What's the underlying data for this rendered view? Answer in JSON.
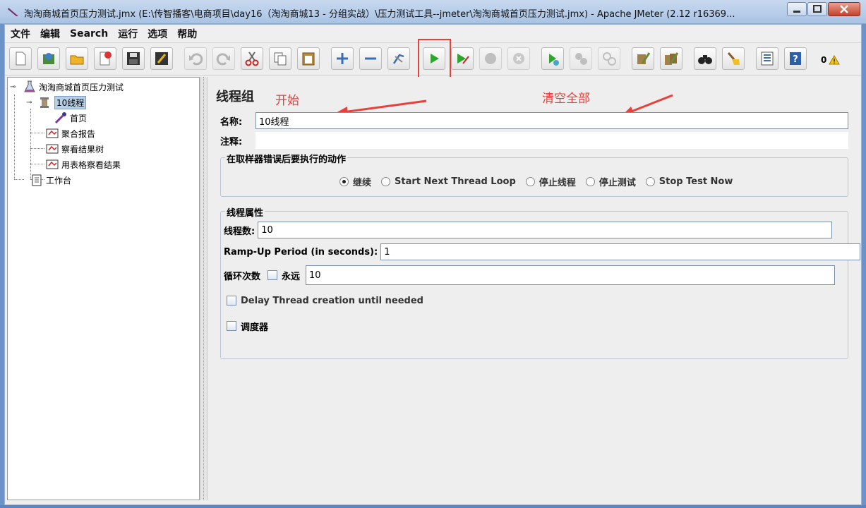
{
  "window": {
    "title": "淘淘商城首页压力测试.jmx (E:\\传智播客\\电商项目\\day16（淘淘商城13 - 分组实战）\\压力测试工具--jmeter\\淘淘商城首页压力测试.jmx) - Apache JMeter (2.12 r16369...",
    "minimize": "minimize",
    "maximize": "maximize",
    "close": "close"
  },
  "menu": [
    "文件",
    "编辑",
    "Search",
    "运行",
    "选项",
    "帮助"
  ],
  "toolbar": {
    "error_count": "0",
    "icons": [
      "new-icon",
      "templates-icon",
      "open-icon",
      "close-icon",
      "save-icon",
      "save-as-icon",
      "undo-icon",
      "redo-icon",
      "cut-icon",
      "copy-icon",
      "paste-icon",
      "expand-icon",
      "collapse-icon",
      "toggle-icon",
      "start-icon",
      "start-no-pauses-icon",
      "stop-icon",
      "shutdown-icon",
      "remote-start-icon",
      "remote-stop-icon",
      "remote-shutdown-icon",
      "clear-icon",
      "clear-all-icon",
      "search-icon",
      "reset-search-icon",
      "function-helper-icon",
      "help-icon"
    ]
  },
  "tree": {
    "root": "淘淘商城首页压力测试",
    "thread_group": "10线程",
    "sampler": "首页",
    "listeners": [
      "聚合报告",
      "察看结果树",
      "用表格察看结果"
    ],
    "workbench": "工作台"
  },
  "panel": {
    "title": "线程组",
    "annotation_start": "开始",
    "annotation_clear_all": "清空全部",
    "name_label": "名称:",
    "name_value": "10线程",
    "comment_label": "注释:",
    "comment_value": "",
    "error_action": {
      "legend": "在取样器错误后要执行的动作",
      "options": [
        "继续",
        "Start Next Thread Loop",
        "停止线程",
        "停止测试",
        "Stop Test Now"
      ],
      "selected": "继续"
    },
    "thread_props": {
      "legend": "线程属性",
      "threads_label": "线程数:",
      "threads_value": "10",
      "rampup_label": "Ramp-Up Period (in seconds):",
      "rampup_value": "1",
      "loop_label": "循环次数",
      "forever_label": "永远",
      "loop_value": "10",
      "delay_label": "Delay Thread creation until needed",
      "scheduler_label": "调度器"
    }
  },
  "colors": {
    "annotation": "#e8403a",
    "selection": "#b8cfe5",
    "start_green": "#2fa52f"
  }
}
